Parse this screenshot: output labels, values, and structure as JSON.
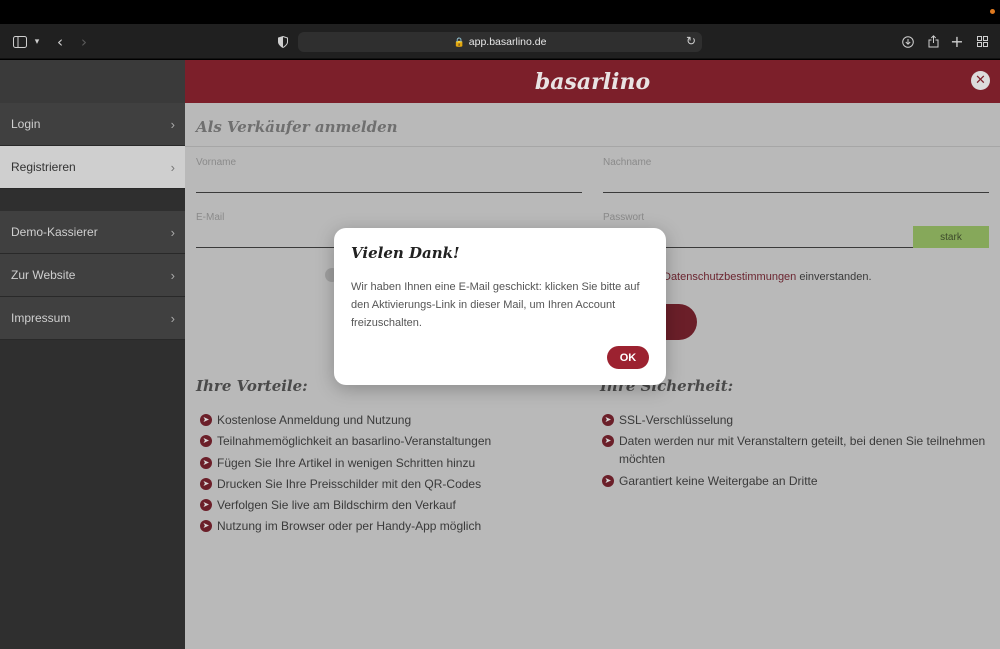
{
  "browser": {
    "url": "app.basarlino.de",
    "icons": [
      "sidebar-toggle-icon",
      "chevron-down-icon",
      "back-icon",
      "forward-icon",
      "shield-icon",
      "lock-icon",
      "reload-icon",
      "download-icon",
      "share-icon",
      "new-tab-icon",
      "tab-overview-icon"
    ]
  },
  "sidebar": {
    "items": [
      {
        "label": "Login"
      },
      {
        "label": "Registrieren"
      },
      {
        "label": "Demo-Kassierer"
      },
      {
        "label": "Zur Website"
      },
      {
        "label": "Impressum"
      }
    ]
  },
  "brand": {
    "name": "basarlino"
  },
  "form": {
    "title": "Als Verkäufer anmelden",
    "firstname_label": "Vorname",
    "lastname_label": "Nachname",
    "email_label": "E-Mail",
    "password_label": "Passwort",
    "strength": "stark",
    "consent_link": "Datenschutzbestimmungen",
    "consent_suffix": "einverstanden."
  },
  "advantages": {
    "title": "Ihre Vorteile:",
    "items": [
      "Kostenlose Anmeldung und Nutzung",
      "Teilnahmemöglichkeit an basarlino-Veranstaltungen",
      "Fügen Sie Ihre Artikel in wenigen Schritten hinzu",
      "Drucken Sie Ihre Preisschilder mit den QR-Codes",
      "Verfolgen Sie live am Bildschirm den Verkauf",
      "Nutzung im Browser oder per Handy-App möglich"
    ]
  },
  "security": {
    "title": "Ihre Sicherheit:",
    "items": [
      "SSL-Verschlüsselung",
      "Daten werden nur mit Veranstaltern geteilt, bei denen Sie teilnehmen möchten",
      "Garantiert keine Weitergabe an Dritte"
    ]
  },
  "modal": {
    "title": "Vielen Dank!",
    "text": "Wir haben Ihnen eine E-Mail geschickt: klicken Sie bitte auf den Aktivierungs-Link in dieser Mail, um Ihren Account freizuschalten.",
    "ok_label": "OK"
  },
  "colors": {
    "brand": "#9c2230",
    "overlay_gray": "#b9b9b9",
    "sidebar": "#2f2f2f",
    "strength_ok": "#86a85a"
  }
}
